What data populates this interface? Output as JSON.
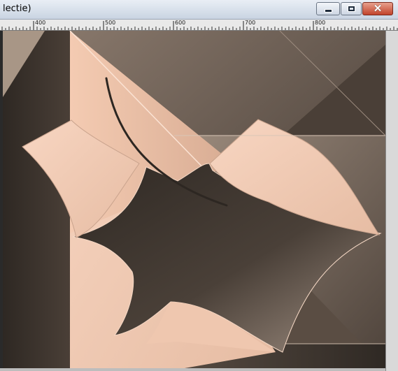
{
  "window": {
    "title": "lectie)",
    "buttons": {
      "minimize": "minimize-icon",
      "maximize": "maximize-icon",
      "close": "close-icon"
    }
  },
  "ruler": {
    "labels": [
      "400",
      "500",
      "600",
      "700",
      "800"
    ]
  },
  "artwork": {
    "palette": {
      "peach": "#f6cdb5",
      "dark_brown": "#3b342e",
      "taupe": "#7d6e62",
      "light_taupe": "#b3a294"
    }
  }
}
